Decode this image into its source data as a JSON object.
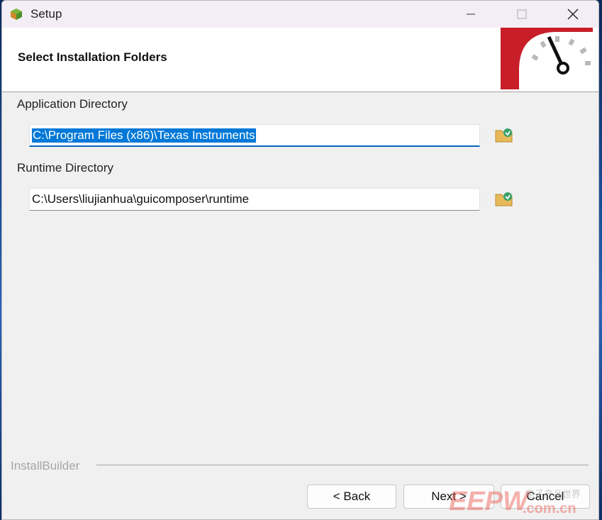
{
  "window": {
    "title": "Setup"
  },
  "header": {
    "title": "Select Installation Folders"
  },
  "fields": [
    {
      "label": "Application Directory",
      "value": "C:\\Program Files (x86)\\Texas Instruments"
    },
    {
      "label": "Runtime Directory",
      "value": "C:\\Users\\liujianhua\\guicomposer\\runtime"
    }
  ],
  "footer": {
    "brand": "InstallBuilder",
    "back_label": "< Back",
    "next_label": "Next >",
    "cancel_label": "Cancel"
  },
  "watermark": {
    "text": "EEPW",
    "domain": ".com.cn",
    "cn": "电子产品世界"
  },
  "colors": {
    "accent": "#0078d7",
    "logo_red": "#c81e28"
  },
  "icons": [
    "app-icon",
    "minimize-icon",
    "maximize-icon",
    "close-icon",
    "speedometer-icon",
    "folder-browse-icon"
  ]
}
